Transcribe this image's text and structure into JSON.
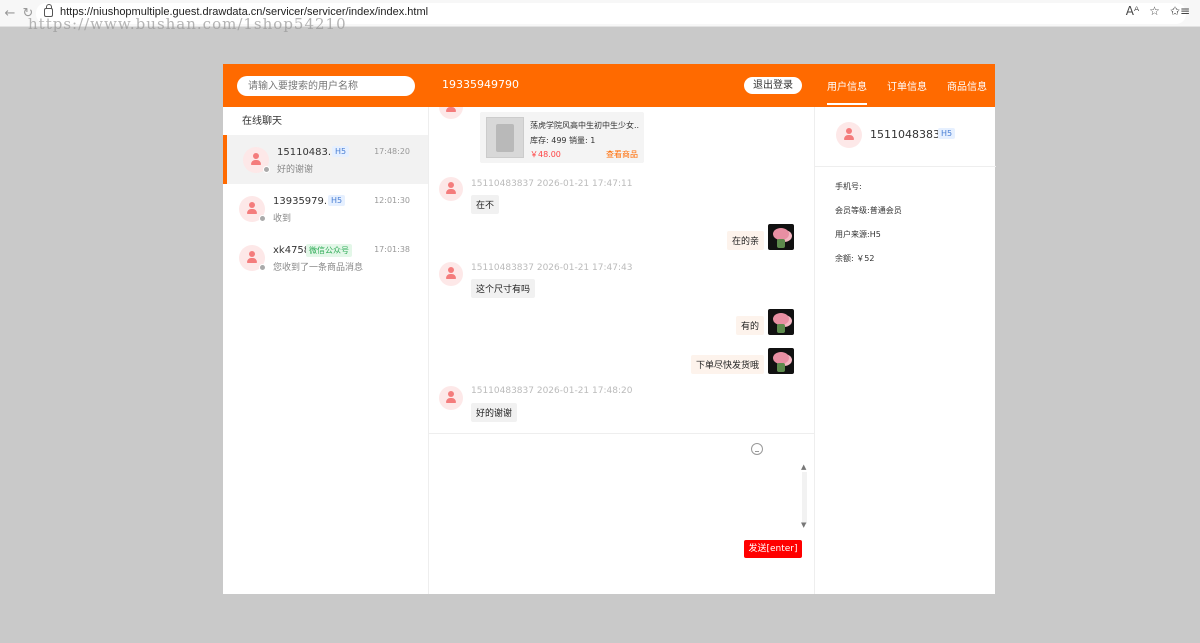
{
  "browser": {
    "url": "https://niushopmultiple.guest.drawdata.cn/servicer/servicer/index/index.html",
    "watermark": "https://www.bushan.com/1shop54210"
  },
  "header": {
    "search_placeholder": "请输入要搜索的用户名称",
    "current_user": "19335949790",
    "logout_label": "退出登录",
    "tabs": [
      {
        "label": "用户信息",
        "active": true
      },
      {
        "label": "订单信息",
        "active": false
      },
      {
        "label": "商品信息",
        "active": false
      }
    ]
  },
  "sidebar": {
    "title": "在线聊天",
    "conversations": [
      {
        "name": "15110483...",
        "badge": "H5",
        "time": "17:48:20",
        "message": "好的谢谢",
        "active": true
      },
      {
        "name": "13935979...",
        "badge": "H5",
        "time": "12:01:30",
        "message": "收到",
        "active": false
      },
      {
        "name": "xk4758",
        "badge": "微信公众号",
        "time": "17:01:38",
        "message": "您收到了一条商品消息",
        "active": false
      }
    ]
  },
  "chat": {
    "product": {
      "title": "荡虎学院风高中生初中生少女...",
      "stock_sales": "库存: 499 销量: 1",
      "price": "￥48.00",
      "view_label": "查看商品"
    },
    "messages": [
      {
        "direction": "in",
        "meta": "15110483837 2026-01-21 17:47:11",
        "text": "在不"
      },
      {
        "direction": "out",
        "text": "在的亲"
      },
      {
        "direction": "in",
        "meta": "15110483837 2026-01-21 17:47:43",
        "text": "这个尺寸有吗"
      },
      {
        "direction": "out",
        "text": "有的"
      },
      {
        "direction": "out",
        "text": "下单尽快发货哦"
      },
      {
        "direction": "in",
        "meta": "15110483837 2026-01-21 17:48:20",
        "text": "好的谢谢"
      }
    ]
  },
  "composer": {
    "value": "",
    "send_label": "发送[enter]"
  },
  "user_panel": {
    "name": "15110483837",
    "badge": "H5",
    "phone": "手机号:",
    "level": "会员等级:普通会员",
    "source": "用户来源:H5",
    "balance": "余额: ￥52"
  },
  "colors": {
    "accent": "#ff6a00",
    "send_button": "#ff0000",
    "background": "#c9c9c9"
  }
}
